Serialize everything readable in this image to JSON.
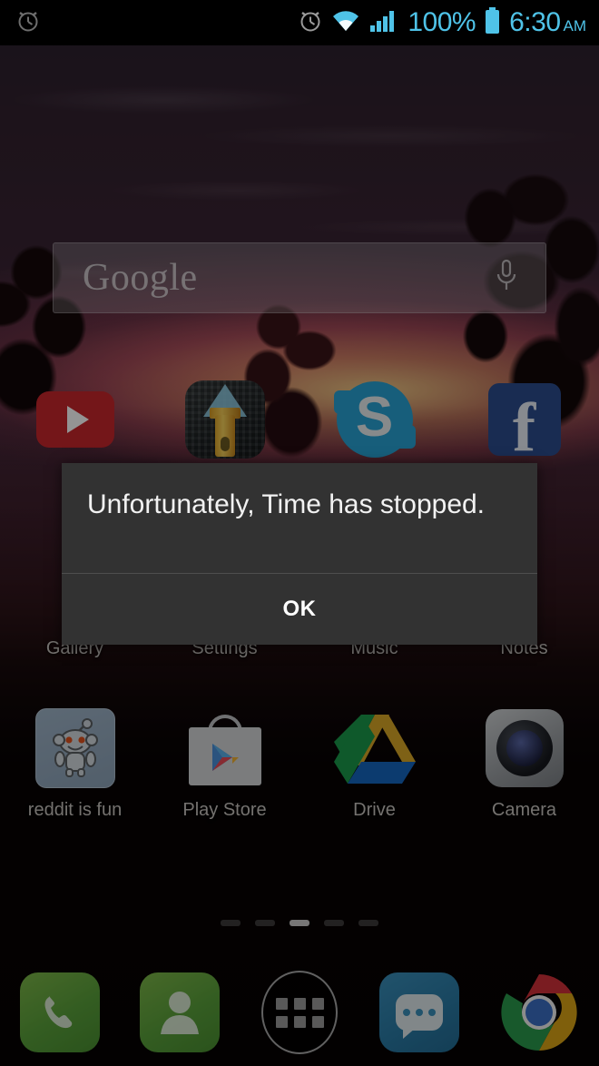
{
  "status_bar": {
    "left_icons": [
      {
        "name": "alarm-icon",
        "label": "Alarm set"
      }
    ],
    "right_icons": [
      {
        "name": "alarm-icon",
        "label": "Alarm set"
      },
      {
        "name": "wifi-icon",
        "label": "Wi-Fi connected"
      },
      {
        "name": "signal-icon",
        "label": "Cellular signal full"
      },
      {
        "name": "battery-icon",
        "label": "Battery full"
      }
    ],
    "battery_percent": "100%",
    "time": "6:30",
    "am_pm": "AM",
    "accent_color": "#4fc3e8",
    "background_color": "#000000"
  },
  "search_widget": {
    "logo_text": "Google",
    "mic_icon": "microphone-icon"
  },
  "home_screen": {
    "rows": [
      {
        "apps": [
          {
            "label": "",
            "icon": "youtube-icon"
          },
          {
            "label": "",
            "icon": "flashlight-icon"
          },
          {
            "label": "",
            "icon": "skype-icon"
          },
          {
            "label": "",
            "icon": "facebook-icon"
          }
        ]
      },
      {
        "apps": [
          {
            "label": "Gallery",
            "icon": "gallery-icon"
          },
          {
            "label": "Settings",
            "icon": "settings-icon"
          },
          {
            "label": "Music",
            "icon": "music-icon"
          },
          {
            "label": "Notes",
            "icon": "notes-icon"
          }
        ]
      },
      {
        "apps": [
          {
            "label": "reddit is fun",
            "icon": "reddit-is-fun-icon"
          },
          {
            "label": "Play Store",
            "icon": "play-store-icon"
          },
          {
            "label": "Drive",
            "icon": "google-drive-icon"
          },
          {
            "label": "Camera",
            "icon": "camera-icon"
          }
        ]
      }
    ],
    "page_indicator": {
      "total_pages": 5,
      "current_page": 3
    }
  },
  "dock": {
    "items": [
      {
        "label": "Phone",
        "icon": "phone-icon"
      },
      {
        "label": "Contacts",
        "icon": "contacts-icon"
      },
      {
        "label": "All Apps",
        "icon": "app-drawer-icon"
      },
      {
        "label": "Messaging",
        "icon": "messaging-icon"
      },
      {
        "label": "Chrome",
        "icon": "chrome-icon"
      }
    ]
  },
  "dialog": {
    "message": "Unfortunately, Time has stopped.",
    "ok_label": "OK",
    "background_color": "#323232",
    "text_color": "#f2f2f2"
  }
}
